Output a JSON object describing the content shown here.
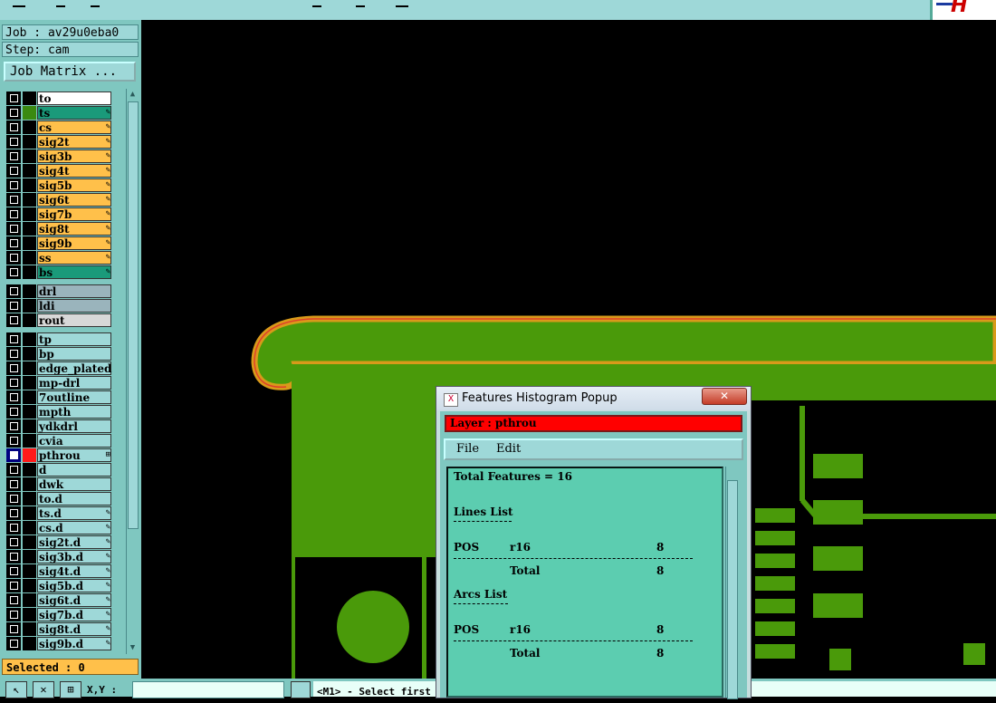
{
  "topbar": {},
  "left_panel": {
    "job": "Job : av29u0eba0",
    "step": "Step: cam",
    "job_matrix": "Job Matrix ...",
    "selected": "Selected : 0"
  },
  "layers": [
    {
      "name": "to",
      "color": "#ffffff",
      "sw": "#000000",
      "editable": false
    },
    {
      "name": "ts",
      "color": "#1a9a7a",
      "sw": "#3a8a10",
      "editable": true
    },
    {
      "name": "cs",
      "color": "#ffc04a",
      "sw": "#000000",
      "editable": true
    },
    {
      "name": "sig2t",
      "color": "#ffc04a",
      "sw": "#000000",
      "editable": true
    },
    {
      "name": "sig3b",
      "color": "#ffc04a",
      "sw": "#000000",
      "editable": true
    },
    {
      "name": "sig4t",
      "color": "#ffc04a",
      "sw": "#000000",
      "editable": true
    },
    {
      "name": "sig5b",
      "color": "#ffc04a",
      "sw": "#000000",
      "editable": true
    },
    {
      "name": "sig6t",
      "color": "#ffc04a",
      "sw": "#000000",
      "editable": true
    },
    {
      "name": "sig7b",
      "color": "#ffc04a",
      "sw": "#000000",
      "editable": true
    },
    {
      "name": "sig8t",
      "color": "#ffc04a",
      "sw": "#000000",
      "editable": true
    },
    {
      "name": "sig9b",
      "color": "#ffc04a",
      "sw": "#000000",
      "editable": true
    },
    {
      "name": "ss",
      "color": "#ffc04a",
      "sw": "#000000",
      "editable": true
    },
    {
      "name": "bs",
      "color": "#1a9a7a",
      "sw": "#000000",
      "editable": true
    },
    {
      "name": "drl",
      "color": "#9ab4bc",
      "sw": "#000000",
      "editable": false
    },
    {
      "name": "ldi",
      "color": "#9ab4bc",
      "sw": "#000000",
      "editable": false
    },
    {
      "name": "rout",
      "color": "#d8d8d8",
      "sw": "#000000",
      "editable": false
    },
    {
      "name": "tp",
      "color": "#9ed8d8",
      "sw": "#000000",
      "editable": false
    },
    {
      "name": "bp",
      "color": "#9ed8d8",
      "sw": "#000000",
      "editable": false
    },
    {
      "name": "edge_plated",
      "color": "#9ed8d8",
      "sw": "#000000",
      "editable": false
    },
    {
      "name": "mp-drl",
      "color": "#9ed8d8",
      "sw": "#000000",
      "editable": false
    },
    {
      "name": "7outline",
      "color": "#9ed8d8",
      "sw": "#000000",
      "editable": false
    },
    {
      "name": "mpth",
      "color": "#9ed8d8",
      "sw": "#000000",
      "editable": false
    },
    {
      "name": "ydkdrl",
      "color": "#9ed8d8",
      "sw": "#000000",
      "editable": false
    },
    {
      "name": "cvia",
      "color": "#9ed8d8",
      "sw": "#000000",
      "editable": false
    },
    {
      "name": "pthrou",
      "color": "#9ed8d8",
      "sw": "#ff1a1a",
      "editable": false,
      "active": true
    },
    {
      "name": "d",
      "color": "#9ed8d8",
      "sw": "#000000",
      "editable": false
    },
    {
      "name": "dwk",
      "color": "#9ed8d8",
      "sw": "#000000",
      "editable": false
    },
    {
      "name": "to.d",
      "color": "#9ed8d8",
      "sw": "#000000",
      "editable": false
    },
    {
      "name": "ts.d",
      "color": "#9ed8d8",
      "sw": "#000000",
      "editable": true
    },
    {
      "name": "cs.d",
      "color": "#9ed8d8",
      "sw": "#000000",
      "editable": true
    },
    {
      "name": "sig2t.d",
      "color": "#9ed8d8",
      "sw": "#000000",
      "editable": true
    },
    {
      "name": "sig3b.d",
      "color": "#9ed8d8",
      "sw": "#000000",
      "editable": true
    },
    {
      "name": "sig4t.d",
      "color": "#9ed8d8",
      "sw": "#000000",
      "editable": true
    },
    {
      "name": "sig5b.d",
      "color": "#9ed8d8",
      "sw": "#000000",
      "editable": true
    },
    {
      "name": "sig6t.d",
      "color": "#9ed8d8",
      "sw": "#000000",
      "editable": true
    },
    {
      "name": "sig7b.d",
      "color": "#9ed8d8",
      "sw": "#000000",
      "editable": true
    },
    {
      "name": "sig8t.d",
      "color": "#9ed8d8",
      "sw": "#000000",
      "editable": true
    },
    {
      "name": "sig9b.d",
      "color": "#9ed8d8",
      "sw": "#000000",
      "editable": true
    }
  ],
  "bottombar": {
    "xy_label": "X,Y :",
    "message": "<M1> - Select first"
  },
  "popup": {
    "title": "Features Histogram Popup",
    "layer": "Layer :  pthrou",
    "menu_file": "File",
    "menu_edit": "Edit",
    "total": "Total Features = 16",
    "lines_list": "Lines List",
    "arcs_list": "Arcs List",
    "pos": "POS",
    "sym": "r16",
    "count": "8",
    "total_label": "Total",
    "total_count": "8"
  },
  "colors": {
    "copper": "#4a9a0a",
    "outline_orange": "#d89a1a",
    "active_layer": "#ff0000",
    "panel": "#7fc7c0"
  }
}
